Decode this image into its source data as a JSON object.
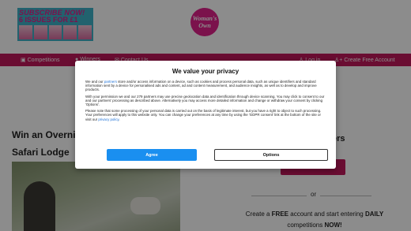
{
  "header": {
    "ad": {
      "line1": "SUBSCRIBE NOW!",
      "line2": "6 ISSUES FOR £1"
    },
    "logo": {
      "line1": "Woman's",
      "line2": "Own"
    }
  },
  "nav": {
    "competitions": "Competitions",
    "winners": "Winners",
    "contact": "Contact Us",
    "login": "Log in",
    "create_account": "Create Free Account"
  },
  "article": {
    "title_line1": "Win an Overnig",
    "title_line2": "Safari Lodge"
  },
  "sidebar": {
    "heading": "ers",
    "or": "or",
    "create_pre": "Create a ",
    "create_bold": "FREE",
    "create_mid": " account and start entering ",
    "create_bold2": "DAILY",
    "create_line2_pre": "competitions ",
    "create_bold3": "NOW!"
  },
  "consent": {
    "title": "We value your privacy",
    "para1_a": "We and our ",
    "para1_link": "partners",
    "para1_b": " store and/or access information on a device, such as cookies and process personal data, such as unique identifiers and standard information sent by a device for personalised ads and content, ad and content measurement, and audience insights, as well as to develop and improve products.",
    "para2": "With your permission we and our 279 partners may use precise geolocation data and identification through device scanning. You may click to consent to our and our partners' processing as described above. Alternatively you may access more detailed information and change or withdraw your consent by clicking 'Options'.",
    "para3_a": "Please note that some processing of your personal data is carried out on the basis of legitimate interest, but you have a right to object to such processing. Your preferences will apply to this website only. You can change your preferences at any time by using the 'GDPR consent' link at the bottom of the site or visit our ",
    "para3_link": "privacy policy",
    "para3_b": ".",
    "agree": "Agree",
    "options": "Options"
  },
  "colors": {
    "brand": "#c2185b",
    "agree_button": "#1a8ff0"
  },
  "icons": [
    "trophy-icon",
    "medal-icon",
    "mail-icon",
    "user-icon",
    "add-user-icon"
  ]
}
